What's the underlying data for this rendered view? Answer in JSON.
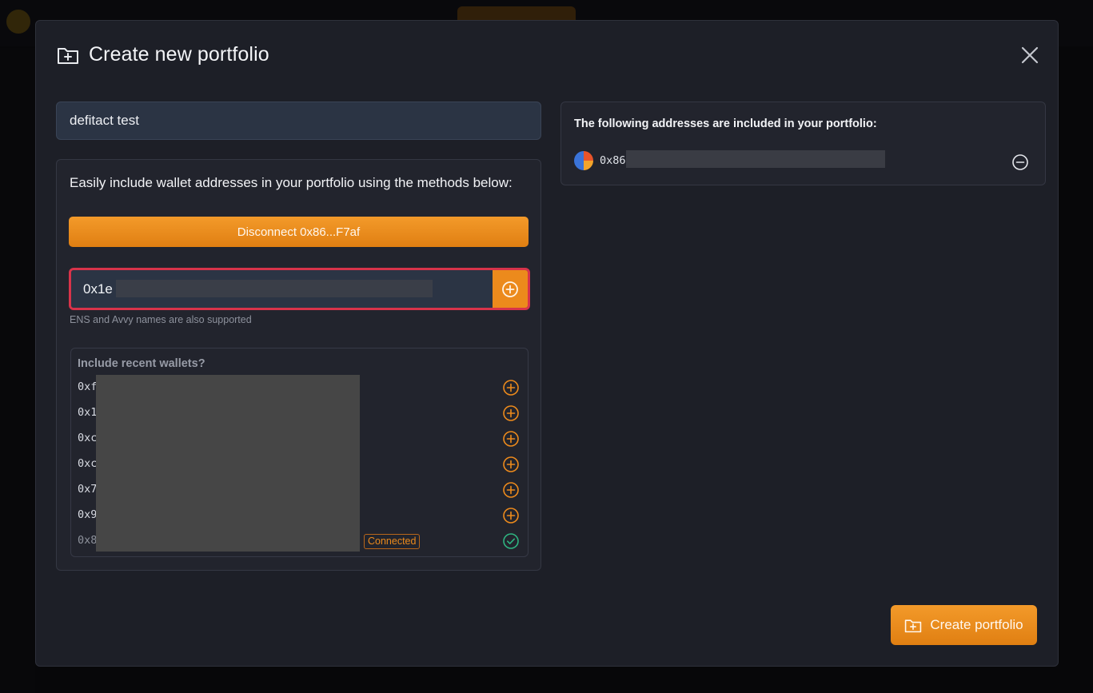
{
  "modal": {
    "title": "Create new portfolio",
    "icon": "folder-plus-icon",
    "close_icon": "close-icon"
  },
  "form": {
    "portfolio_name_value": "defitact test",
    "methods_heading": "Easily include wallet addresses in your portfolio using the methods below:",
    "disconnect_label": "Disconnect 0x86...F7af",
    "address_input_value": "0x1e",
    "ens_hint": "ENS and Avvy names are also supported",
    "recent_title": "Include recent wallets?",
    "recent_wallets": [
      {
        "address": "0xf",
        "action": "add"
      },
      {
        "address": "0x1",
        "action": "add"
      },
      {
        "address": "0xc",
        "action": "add"
      },
      {
        "address": "0xc",
        "action": "add"
      },
      {
        "address": "0x7",
        "action": "add"
      },
      {
        "address": "0x9",
        "action": "add"
      },
      {
        "address": "0x8",
        "action": "connected",
        "badge": "Connected"
      }
    ]
  },
  "included": {
    "heading": "The following addresses are included in your portfolio:",
    "addresses": [
      {
        "address": "0x86"
      }
    ]
  },
  "footer": {
    "create_label": "Create portfolio"
  },
  "colors": {
    "accent": "#ec8a1c",
    "error_border": "#d8334a",
    "success": "#2fb380"
  }
}
